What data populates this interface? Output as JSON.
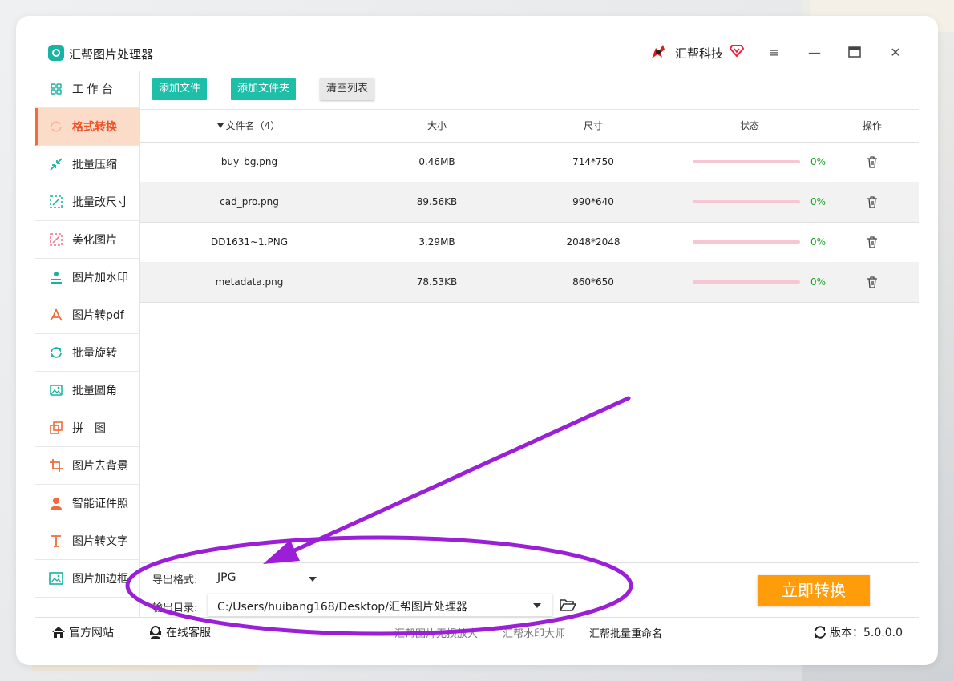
{
  "window": {
    "app_title": "汇帮图片处理器",
    "brand_name": "汇帮科技",
    "colors": {
      "accent_teal": "#1dbfa9",
      "active_orange": "#f04e23",
      "convert_orange": "#ff9c0a",
      "annotation_purple": "#9b1fd6"
    }
  },
  "sidebar": {
    "items": [
      {
        "label": "工 作 台",
        "icon": "grid-icon",
        "active": false
      },
      {
        "label": "格式转换",
        "icon": "convert-icon",
        "active": true
      },
      {
        "label": "批量压缩",
        "icon": "compress-icon",
        "active": false
      },
      {
        "label": "批量改尺寸",
        "icon": "resize-icon",
        "active": false
      },
      {
        "label": "美化图片",
        "icon": "beautify-icon",
        "active": false
      },
      {
        "label": "图片加水印",
        "icon": "watermark-icon",
        "active": false
      },
      {
        "label": "图片转pdf",
        "icon": "pdf-icon",
        "active": false
      },
      {
        "label": "批量旋转",
        "icon": "rotate-icon",
        "active": false
      },
      {
        "label": "批量圆角",
        "icon": "rounded-corner-icon",
        "active": false
      },
      {
        "label": "拼　图",
        "icon": "collage-icon",
        "active": false
      },
      {
        "label": "图片去背景",
        "icon": "crop-icon",
        "active": false
      },
      {
        "label": "智能证件照",
        "icon": "person-icon",
        "active": false
      },
      {
        "label": "图片转文字",
        "icon": "text-icon",
        "active": false
      },
      {
        "label": "图片加边框",
        "icon": "frame-icon",
        "active": false
      }
    ]
  },
  "toolbar": {
    "add_file": "添加文件",
    "add_folder": "添加文件夹",
    "clear_list": "清空列表"
  },
  "table": {
    "headers": {
      "name": "文件名（4）",
      "size": "大小",
      "dimensions": "尺寸",
      "status": "状态",
      "actions": "操作"
    },
    "rows": [
      {
        "name": "buy_bg.png",
        "size": "0.46MB",
        "dimensions": "714*750",
        "progress_text": "0%",
        "progress": 0
      },
      {
        "name": "cad_pro.png",
        "size": "89.56KB",
        "dimensions": "990*640",
        "progress_text": "0%",
        "progress": 0
      },
      {
        "name": "DD1631~1.PNG",
        "size": "3.29MB",
        "dimensions": "2048*2048",
        "progress_text": "0%",
        "progress": 0
      },
      {
        "name": "metadata.png",
        "size": "78.53KB",
        "dimensions": "860*650",
        "progress_text": "0%",
        "progress": 0
      }
    ]
  },
  "options": {
    "format_label": "导出格式:",
    "format_value": "JPG",
    "output_label": "输出目录:",
    "output_value": "C:/Users/huibang168/Desktop/汇帮图片处理器",
    "convert_button": "立即转换"
  },
  "statusbar": {
    "official_site": "官方网站",
    "online_service": "在线客服",
    "link_1": "汇帮图片无损放大",
    "link_2": "汇帮水印大师",
    "link_3": "汇帮批量重命名",
    "version": "版本：5.0.0.0"
  }
}
